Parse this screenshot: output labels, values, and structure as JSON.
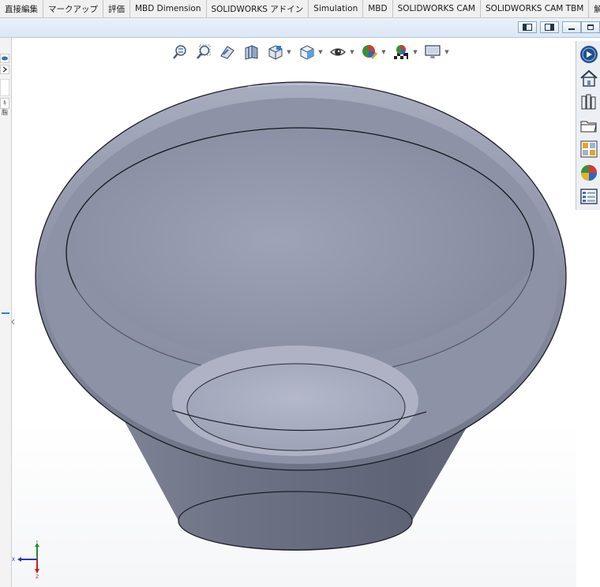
{
  "tabs": [
    {
      "label": "直接編集"
    },
    {
      "label": "マークアップ"
    },
    {
      "label": "評価"
    },
    {
      "label": "MBD Dimension"
    },
    {
      "label": "SOLIDWORKS アドイン"
    },
    {
      "label": "Simulation"
    },
    {
      "label": "MBD"
    },
    {
      "label": "SOLIDWORKS CAM"
    },
    {
      "label": "SOLIDWORKS CAM TBM"
    },
    {
      "label": "解析の準備"
    }
  ],
  "left_panel": {
    "partial_label": "ｷ 脂"
  },
  "heads_up_toolbar": [
    {
      "icon": "zoom-to-fit-icon"
    },
    {
      "icon": "zoom-to-area-icon"
    },
    {
      "icon": "previous-view-icon"
    },
    {
      "icon": "section-view-icon"
    },
    {
      "icon": "view-orientation-icon",
      "dropdown": true
    },
    {
      "icon": "display-style-icon",
      "dropdown": true
    },
    {
      "icon": "hide-show-items-icon",
      "dropdown": true
    },
    {
      "icon": "edit-appearance-icon",
      "dropdown": true
    },
    {
      "icon": "apply-scene-icon",
      "dropdown": true
    },
    {
      "icon": "view-settings-icon",
      "dropdown": true
    }
  ],
  "task_pane": [
    {
      "icon": "solidworks-resources-icon"
    },
    {
      "icon": "home-icon"
    },
    {
      "icon": "design-library-icon"
    },
    {
      "icon": "file-explorer-icon"
    },
    {
      "icon": "view-palette-icon"
    },
    {
      "icon": "appearances-scenes-icon"
    },
    {
      "icon": "custom-properties-icon"
    }
  ],
  "triad": {
    "x_label": "X",
    "y_label": "Y",
    "z_label": "Z"
  },
  "colors": {
    "model_body": "#7c8193",
    "model_inner": "#9599ac",
    "viewport_bg": "#ffffff",
    "tab_bg": "#f0f0f0",
    "strip_bg": "#dbe7f5"
  }
}
